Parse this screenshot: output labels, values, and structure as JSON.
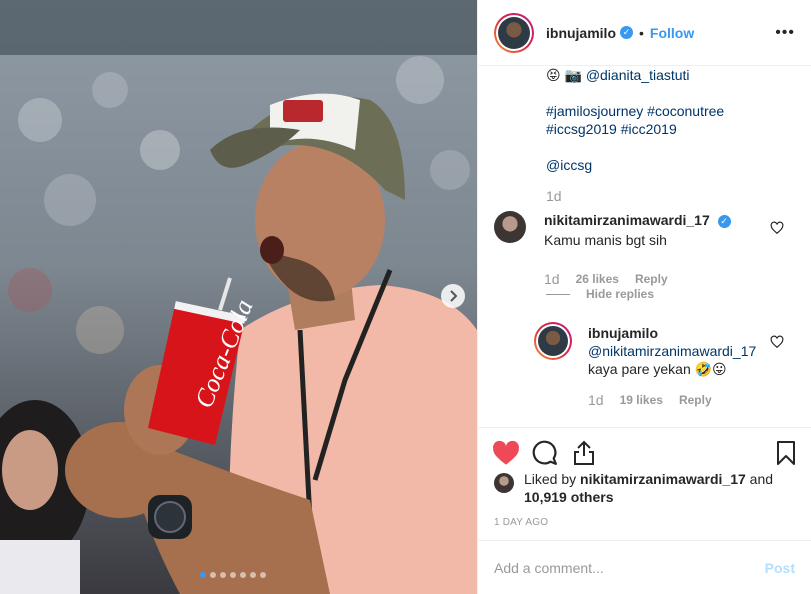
{
  "post": {
    "username": "ibnujamilo",
    "follow_label": "Follow",
    "separator": "•",
    "more_label": "•••"
  },
  "caption": {
    "emojis": "😝 📷",
    "credit": "@dianita_tiastuti",
    "hashtags_line1": "#jamilosjourney #coconutree",
    "hashtags_line2": "#iccsg2019 #icc2019",
    "mention": "@iccsg",
    "age": "1d"
  },
  "comments": [
    {
      "username": "nikitamirzanimawardi_17",
      "text": "Kamu manis bgt sih",
      "age": "1d",
      "likes": "26 likes",
      "reply_label": "Reply"
    }
  ],
  "hide_replies_label": "Hide replies",
  "reply": {
    "username": "ibnujamilo",
    "mention": "@nikitamirzanimawardi_17",
    "text": "kaya pare yekan 🤣😛",
    "age": "1d",
    "likes": "19 likes",
    "reply_label": "Reply"
  },
  "likes_summary": {
    "prefix": "Liked by ",
    "user": "nikitamirzanimawardi_17",
    "middle": " and",
    "count": "10,919 others"
  },
  "timestamp": "1 DAY AGO",
  "add_comment": {
    "placeholder": "Add a comment...",
    "post_label": "Post"
  },
  "carousel": {
    "total": 7,
    "active_index": 0
  },
  "colors": {
    "accent": "#3897f0",
    "heart": "#ed4956",
    "shirt": "#f3b9a8",
    "cup": "#d7141a"
  }
}
